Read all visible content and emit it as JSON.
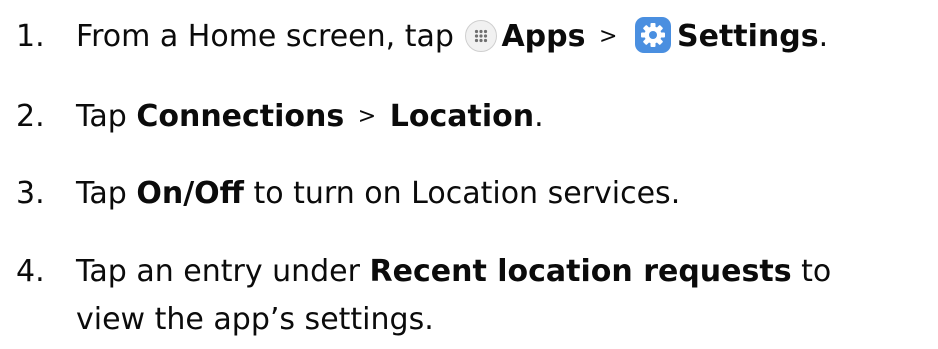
{
  "steps": [
    {
      "number": "1.",
      "parts": {
        "a": "From a Home screen, tap",
        "b_apps": "Apps",
        "sep": ">",
        "b_settings": "Settings",
        "end": "."
      },
      "icons": [
        "apps-grid-icon",
        "settings-gear-icon"
      ]
    },
    {
      "number": "2.",
      "parts": {
        "a": "Tap ",
        "b_connections": "Connections",
        "sep": ">",
        "b_location": "Location",
        "end": "."
      }
    },
    {
      "number": "3.",
      "parts": {
        "a": "Tap ",
        "b_onoff": "On/Off",
        "c": " to turn on Location services."
      }
    },
    {
      "number": "4.",
      "parts": {
        "a": "Tap an entry under ",
        "b_recent": "Recent location requests",
        "c": " to view the app’s settings."
      }
    }
  ],
  "colors": {
    "text": "#0b0b0b",
    "settings_icon_bg": "#4a8fe0",
    "apps_icon_bg": "#f1f1f1"
  }
}
